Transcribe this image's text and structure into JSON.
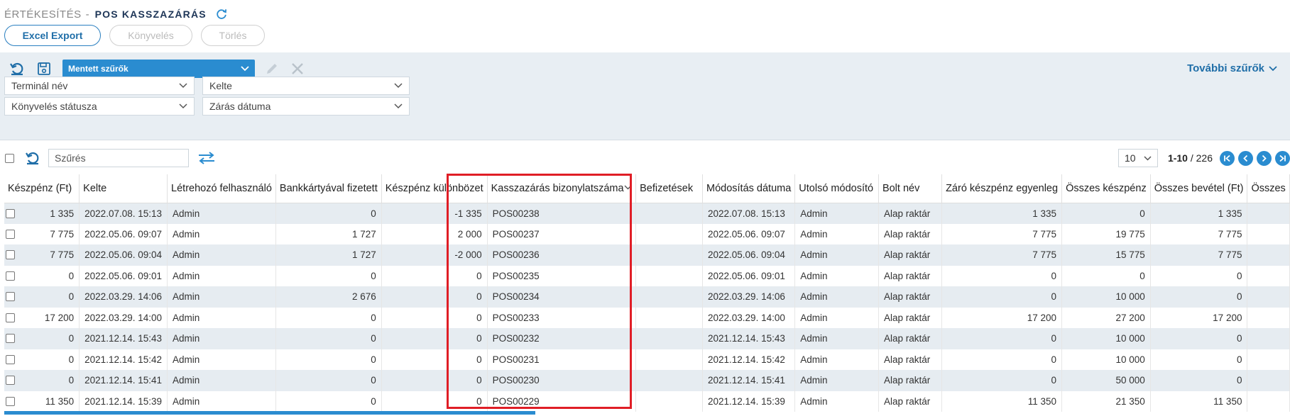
{
  "header": {
    "breadcrumb": "ÉRTÉKESÍTÉS",
    "separator": "-",
    "title": "POS KASSZAZÁRÁS"
  },
  "actions": {
    "excel_export": "Excel Export",
    "konyveles": "Könyvelés",
    "torles": "Törlés"
  },
  "filter_toolbar": {
    "saved_filters": "Mentett szűrők",
    "more_filters": "További szűrők"
  },
  "filters": {
    "terminal": "Terminál név",
    "kelte": "Kelte",
    "konyveles_status": "Könyvelés státusza",
    "zaras_datuma": "Zárás dátuma"
  },
  "grid": {
    "search_value": "Szűrés",
    "page_size": "10",
    "range": "1-10",
    "total": "/ 226"
  },
  "colors": {
    "accent": "#2a8cd0",
    "highlight": "#e01e26",
    "row_stripe": "#e6ecf1"
  },
  "columns": [
    "Készpénz (Ft)",
    "Kelte",
    "Létrehozó felhasználó",
    "Bankkártyával fizetett",
    "Készpénz különbözet",
    "Kasszazárás bizonylatszáma",
    "Befizetések",
    "Módosítás dátuma",
    "Utolsó módosító",
    "Bolt név",
    "Záró készpénz egyenleg",
    "Összes készpénz",
    "Összes bevétel (Ft)",
    "Összes"
  ],
  "rows": [
    [
      "1 335",
      "2022.07.08. 15:13",
      "Admin",
      "0",
      "-1 335",
      "POS00238",
      "",
      "2022.07.08. 15:13",
      "Admin",
      "Alap raktár",
      "1 335",
      "0",
      "1 335"
    ],
    [
      "7 775",
      "2022.05.06. 09:07",
      "Admin",
      "1 727",
      "2 000",
      "POS00237",
      "",
      "2022.05.06. 09:07",
      "Admin",
      "Alap raktár",
      "7 775",
      "19 775",
      "7 775"
    ],
    [
      "7 775",
      "2022.05.06. 09:04",
      "Admin",
      "1 727",
      "-2 000",
      "POS00236",
      "",
      "2022.05.06. 09:04",
      "Admin",
      "Alap raktár",
      "7 775",
      "15 775",
      "7 775"
    ],
    [
      "0",
      "2022.05.06. 09:01",
      "Admin",
      "0",
      "0",
      "POS00235",
      "",
      "2022.05.06. 09:01",
      "Admin",
      "Alap raktár",
      "0",
      "0",
      "0"
    ],
    [
      "0",
      "2022.03.29. 14:06",
      "Admin",
      "2 676",
      "0",
      "POS00234",
      "",
      "2022.03.29. 14:06",
      "Admin",
      "Alap raktár",
      "0",
      "10 000",
      "0"
    ],
    [
      "17 200",
      "2022.03.29. 14:00",
      "Admin",
      "0",
      "0",
      "POS00233",
      "",
      "2022.03.29. 14:00",
      "Admin",
      "Alap raktár",
      "17 200",
      "27 200",
      "17 200"
    ],
    [
      "0",
      "2021.12.14. 15:43",
      "Admin",
      "0",
      "0",
      "POS00232",
      "",
      "2021.12.14. 15:43",
      "Admin",
      "Alap raktár",
      "0",
      "10 000",
      "0"
    ],
    [
      "0",
      "2021.12.14. 15:42",
      "Admin",
      "0",
      "0",
      "POS00231",
      "",
      "2021.12.14. 15:42",
      "Admin",
      "Alap raktár",
      "0",
      "10 000",
      "0"
    ],
    [
      "0",
      "2021.12.14. 15:41",
      "Admin",
      "0",
      "0",
      "POS00230",
      "",
      "2021.12.14. 15:41",
      "Admin",
      "Alap raktár",
      "0",
      "50 000",
      "0"
    ],
    [
      "11 350",
      "2021.12.14. 15:39",
      "Admin",
      "0",
      "0",
      "POS00229",
      "",
      "2021.12.14. 15:39",
      "Admin",
      "Alap raktár",
      "11 350",
      "21 350",
      "11 350"
    ]
  ]
}
